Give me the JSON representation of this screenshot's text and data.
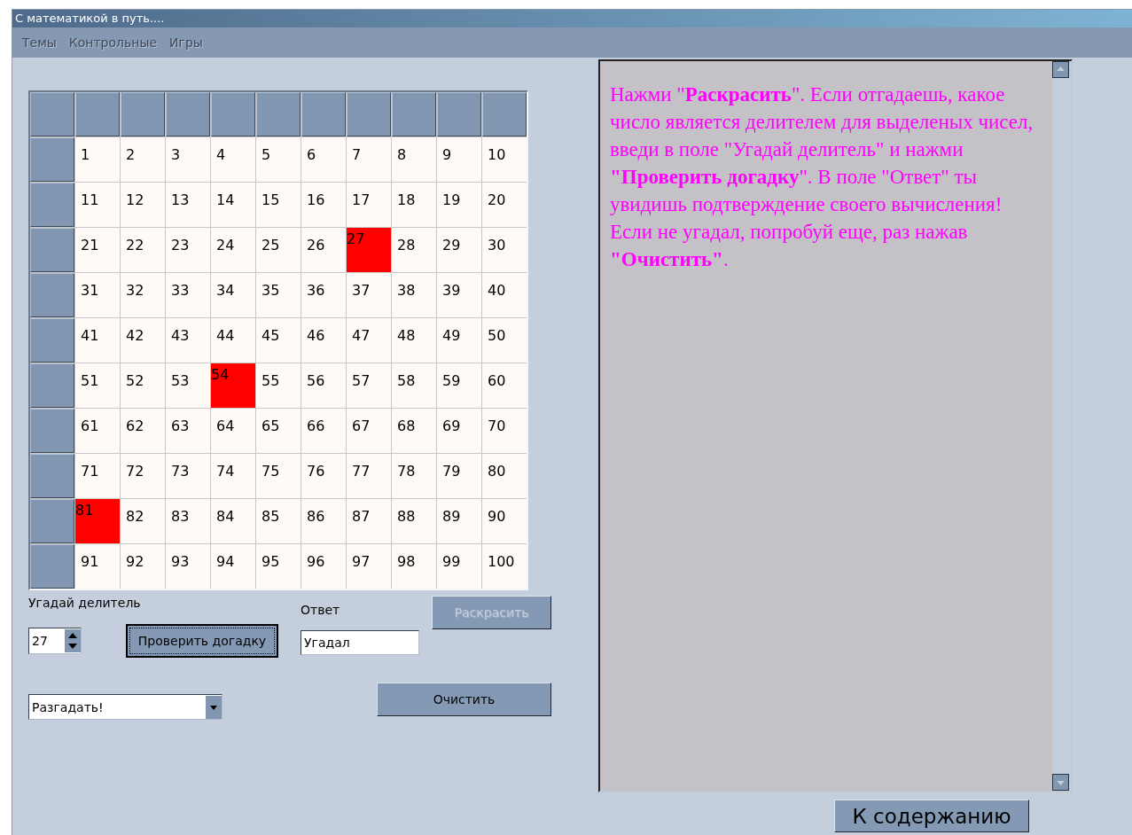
{
  "window": {
    "title": "С математикой в путь...."
  },
  "menu": [
    {
      "label": "Темы",
      "disabled": true
    },
    {
      "label": "Контрольные",
      "disabled": true
    },
    {
      "label": "Игры",
      "disabled": true
    }
  ],
  "grid": {
    "rows": [
      [
        {
          "text": "1",
          "marked": false
        },
        {
          "text": "2",
          "marked": false
        },
        {
          "text": "3",
          "marked": false
        },
        {
          "text": "4",
          "marked": false
        },
        {
          "text": "5",
          "marked": false
        },
        {
          "text": "6",
          "marked": false
        },
        {
          "text": "7",
          "marked": false
        },
        {
          "text": "8",
          "marked": false
        },
        {
          "text": "9",
          "marked": false
        },
        {
          "text": "10",
          "marked": false
        }
      ],
      [
        {
          "text": "11",
          "marked": false
        },
        {
          "text": "12",
          "marked": false
        },
        {
          "text": "13",
          "marked": false
        },
        {
          "text": "14",
          "marked": false
        },
        {
          "text": "15",
          "marked": false
        },
        {
          "text": "16",
          "marked": false
        },
        {
          "text": "17",
          "marked": false
        },
        {
          "text": "18",
          "marked": false
        },
        {
          "text": "19",
          "marked": false
        },
        {
          "text": "20",
          "marked": false
        }
      ],
      [
        {
          "text": "21",
          "marked": false
        },
        {
          "text": "22",
          "marked": false
        },
        {
          "text": "23",
          "marked": false
        },
        {
          "text": "24",
          "marked": false
        },
        {
          "text": "25",
          "marked": false
        },
        {
          "text": "26",
          "marked": false
        },
        {
          "text": "27",
          "marked": true
        },
        {
          "text": "28",
          "marked": false
        },
        {
          "text": "29",
          "marked": false
        },
        {
          "text": "30",
          "marked": false
        }
      ],
      [
        {
          "text": "31",
          "marked": false
        },
        {
          "text": "32",
          "marked": false
        },
        {
          "text": "33",
          "marked": false
        },
        {
          "text": "34",
          "marked": false
        },
        {
          "text": "35",
          "marked": false
        },
        {
          "text": "36",
          "marked": false
        },
        {
          "text": "37",
          "marked": false
        },
        {
          "text": "38",
          "marked": false
        },
        {
          "text": "39",
          "marked": false
        },
        {
          "text": "40",
          "marked": false
        }
      ],
      [
        {
          "text": "41",
          "marked": false
        },
        {
          "text": "42",
          "marked": false
        },
        {
          "text": "43",
          "marked": false
        },
        {
          "text": "44",
          "marked": false
        },
        {
          "text": "45",
          "marked": false
        },
        {
          "text": "46",
          "marked": false
        },
        {
          "text": "47",
          "marked": false
        },
        {
          "text": "48",
          "marked": false
        },
        {
          "text": "49",
          "marked": false
        },
        {
          "text": "50",
          "marked": false
        }
      ],
      [
        {
          "text": "51",
          "marked": false
        },
        {
          "text": "52",
          "marked": false
        },
        {
          "text": "53",
          "marked": false
        },
        {
          "text": "54",
          "marked": true
        },
        {
          "text": "55",
          "marked": false
        },
        {
          "text": "56",
          "marked": false
        },
        {
          "text": "57",
          "marked": false
        },
        {
          "text": "58",
          "marked": false
        },
        {
          "text": "59",
          "marked": false
        },
        {
          "text": "60",
          "marked": false
        }
      ],
      [
        {
          "text": "61",
          "marked": false
        },
        {
          "text": "62",
          "marked": false
        },
        {
          "text": "63",
          "marked": false
        },
        {
          "text": "64",
          "marked": false
        },
        {
          "text": "65",
          "marked": false
        },
        {
          "text": "66",
          "marked": false
        },
        {
          "text": "67",
          "marked": false
        },
        {
          "text": "68",
          "marked": false
        },
        {
          "text": "69",
          "marked": false
        },
        {
          "text": "70",
          "marked": false
        }
      ],
      [
        {
          "text": "71",
          "marked": false
        },
        {
          "text": "72",
          "marked": false
        },
        {
          "text": "73",
          "marked": false
        },
        {
          "text": "74",
          "marked": false
        },
        {
          "text": "75",
          "marked": false
        },
        {
          "text": "76",
          "marked": false
        },
        {
          "text": "77",
          "marked": false
        },
        {
          "text": "78",
          "marked": false
        },
        {
          "text": "79",
          "marked": false
        },
        {
          "text": "80",
          "marked": false
        }
      ],
      [
        {
          "text": "81",
          "marked": true
        },
        {
          "text": "82",
          "marked": false
        },
        {
          "text": "83",
          "marked": false
        },
        {
          "text": "84",
          "marked": false
        },
        {
          "text": "85",
          "marked": false
        },
        {
          "text": "86",
          "marked": false
        },
        {
          "text": "87",
          "marked": false
        },
        {
          "text": "88",
          "marked": false
        },
        {
          "text": "89",
          "marked": false
        },
        {
          "text": "90",
          "marked": false
        }
      ],
      [
        {
          "text": "91",
          "marked": false
        },
        {
          "text": "92",
          "marked": false
        },
        {
          "text": "93",
          "marked": false
        },
        {
          "text": "94",
          "marked": false
        },
        {
          "text": "95",
          "marked": false
        },
        {
          "text": "96",
          "marked": false
        },
        {
          "text": "97",
          "marked": false
        },
        {
          "text": "98",
          "marked": false
        },
        {
          "text": "99",
          "marked": false
        },
        {
          "text": "100",
          "marked": false
        }
      ]
    ]
  },
  "divisor": {
    "label": "Угадай делитель",
    "value": "27"
  },
  "check_button": {
    "label": "Проверить догадку",
    "focused": true
  },
  "answer": {
    "label": "Ответ",
    "value": "Угадал"
  },
  "color_button": {
    "label": "Раскрасить",
    "disabled": true
  },
  "mode_select": {
    "value": "Разгадать!"
  },
  "clear_button": {
    "label": "Очистить",
    "disabled": false
  },
  "instructions": "Нажми \"**Раскрасить**\". Если отгадаешь, какое число является делителем для выделеных чисел, введи в поле \"Угадай делитель\" и нажми **\"Проверить догадку**\". В поле \"Ответ\" ты увидишь подтверждение своего вычисления! Если не угадал, попробуй еще, раз нажав **\"Очистить\"**.",
  "contents_button": {
    "label": "К содержанию",
    "disabled": false
  }
}
